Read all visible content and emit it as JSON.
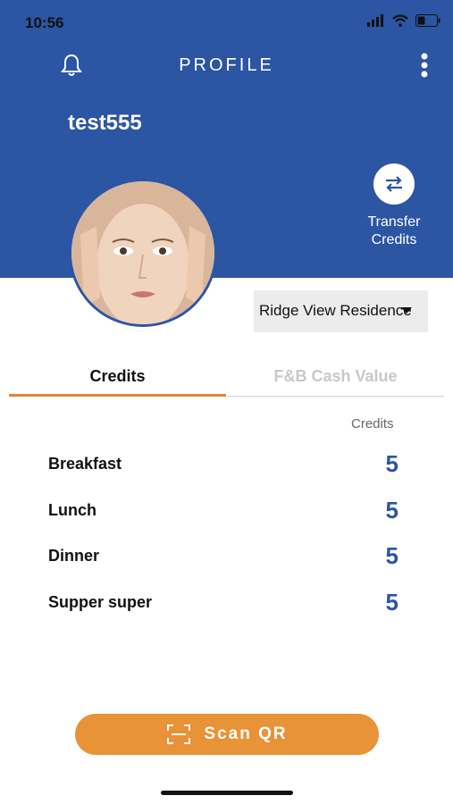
{
  "status_bar": {
    "time": "10:56"
  },
  "header": {
    "title": "PROFILE",
    "username": "test555",
    "transfer_label_line1": "Transfer",
    "transfer_label_line2": "Credits",
    "bg_color": "#2c55a3"
  },
  "location": {
    "selected": "Ridge View Residence"
  },
  "tabs": [
    {
      "label": "Credits",
      "active": true
    },
    {
      "label": "F&B Cash Value",
      "active": false
    }
  ],
  "credits": {
    "column_header": "Credits",
    "rows": [
      {
        "label": "Breakfast",
        "value": "5"
      },
      {
        "label": "Lunch",
        "value": "5"
      },
      {
        "label": "Dinner",
        "value": "5"
      },
      {
        "label": "Supper super",
        "value": "5"
      }
    ]
  },
  "scan": {
    "label": "Scan QR",
    "color": "#e89338"
  },
  "icons": [
    "bell-icon",
    "kebab-menu-icon",
    "transfer-icon",
    "scan-qr-icon"
  ]
}
